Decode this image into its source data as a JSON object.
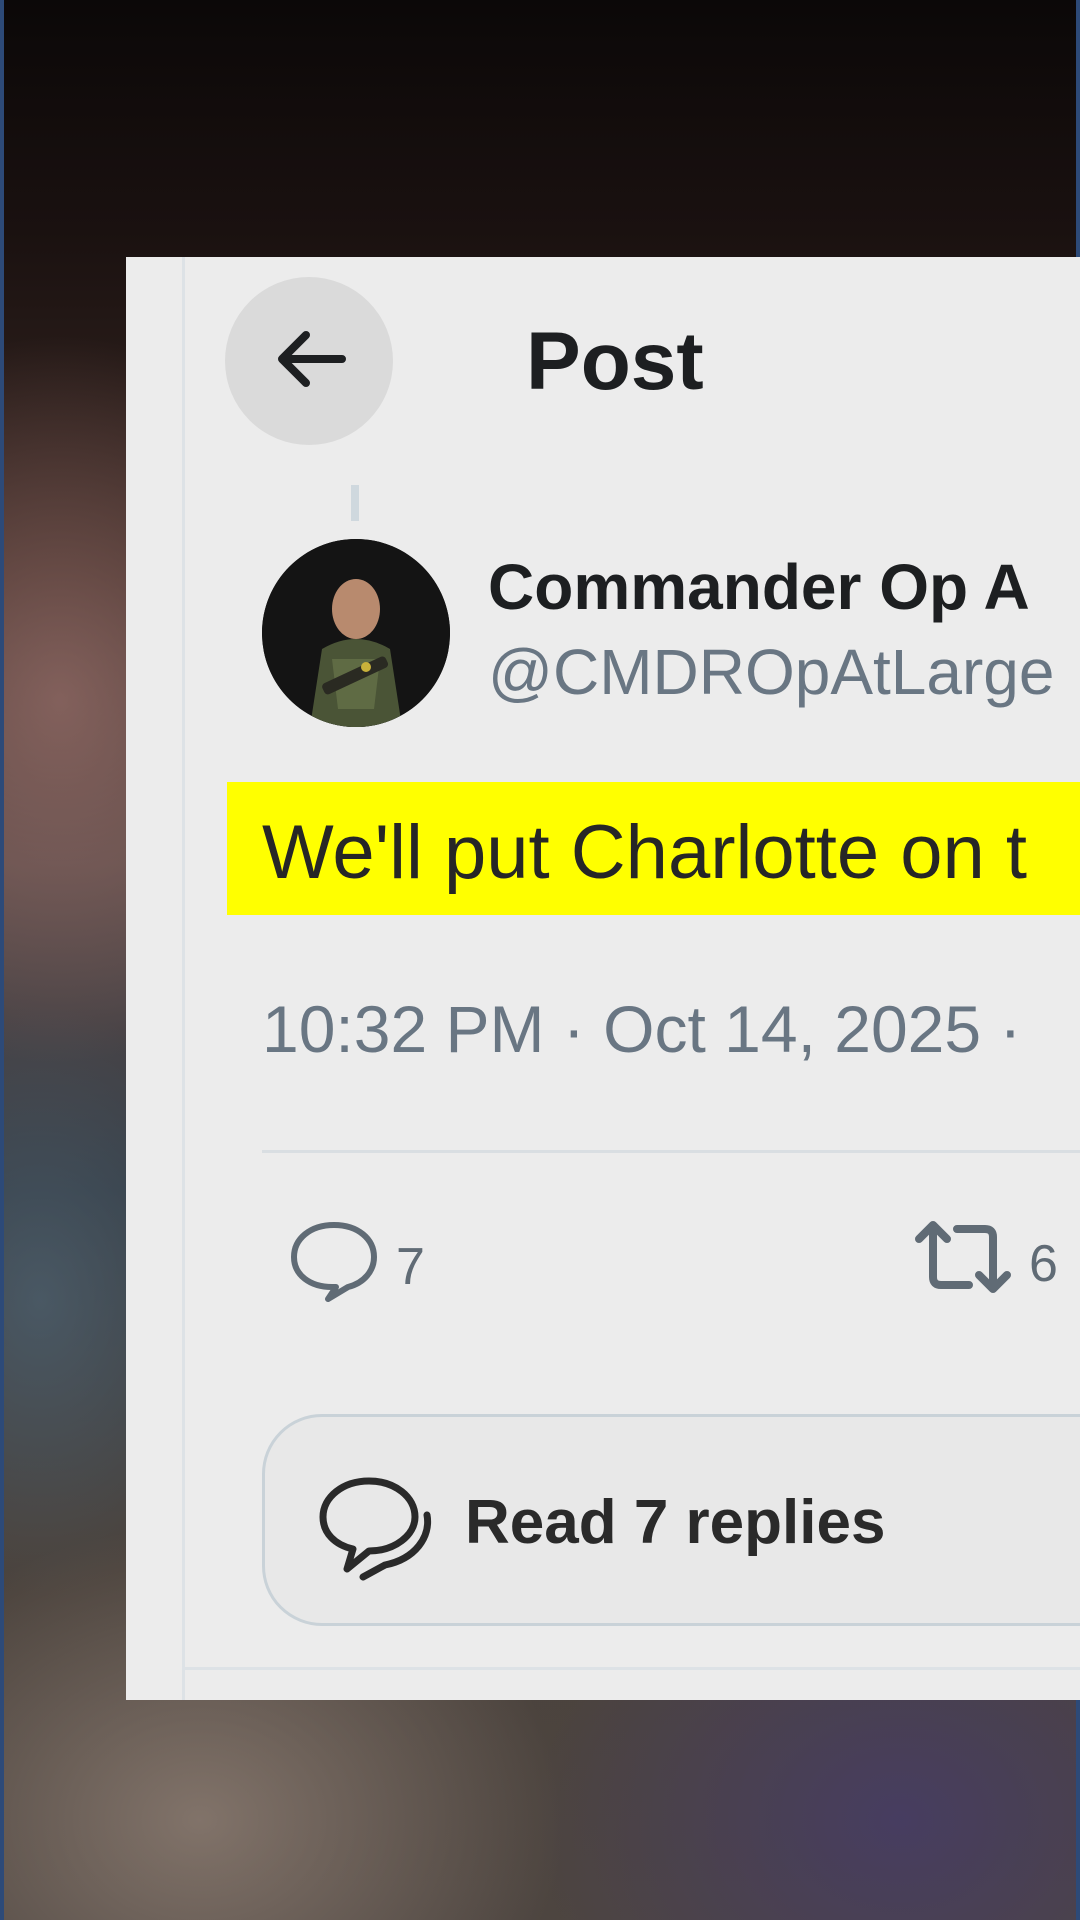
{
  "header": {
    "back_icon": "arrow-left-icon",
    "title": "Post"
  },
  "post": {
    "avatar_icon": "profile-photo-soldier",
    "display_name": "Commander Op A",
    "handle": "@CMDROpAtLarge",
    "text": "We'll put Charlotte on t",
    "highlight_color": "#ffff00",
    "timestamp": "10:32 PM · Oct 14, 2025 ·"
  },
  "actions": {
    "reply_icon": "speech-bubble-icon",
    "reply_count": "7",
    "repost_icon": "repost-icon",
    "repost_count": "6"
  },
  "read_replies": {
    "icon": "conversation-bubbles-icon",
    "label": "Read 7 replies"
  }
}
